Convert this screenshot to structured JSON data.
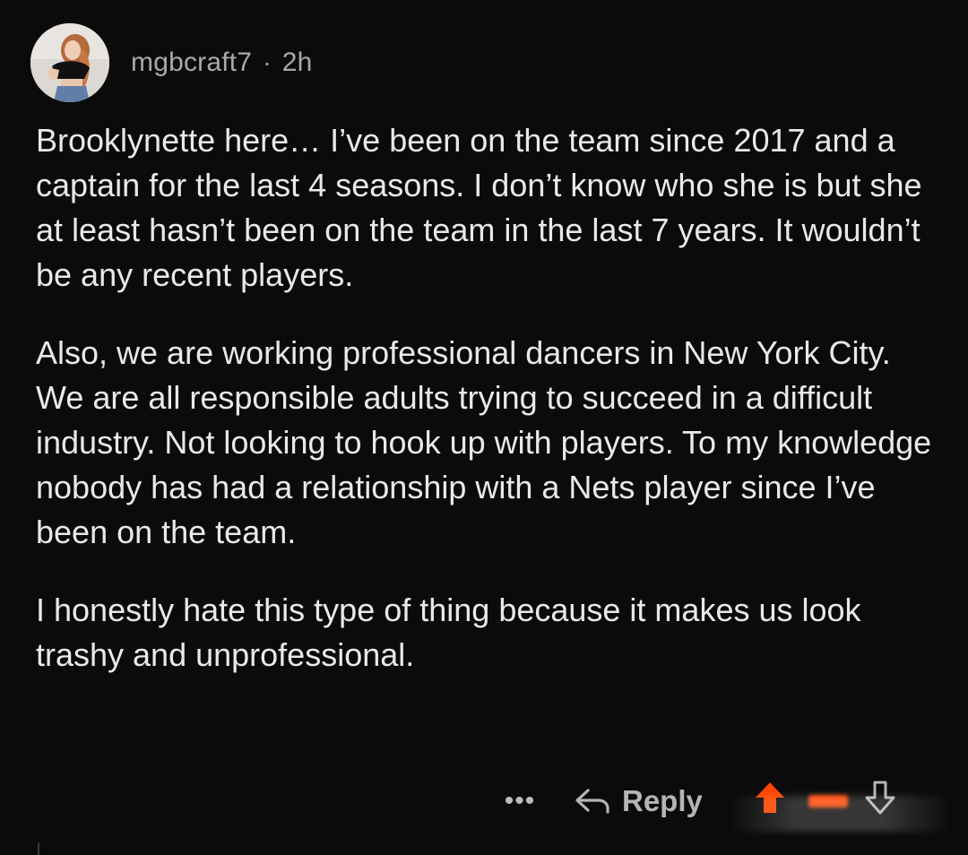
{
  "comment": {
    "author": "mgbcraft7",
    "separator": "·",
    "age": "2h",
    "paragraphs": [
      "Brooklynette here… I’ve been on the team since 2017 and a captain for the last 4 seasons. I don’t know who she is but she at least hasn’t been on the team in the last 7 years. It wouldn’t be any recent players.",
      "Also, we are working professional dancers in New York City. We are all responsible adults trying to succeed in a difficult industry. Not looking to hook up with players. To my knowledge nobody has had a relationship with a Nets player since I’ve been on the team.",
      "I honestly hate this type of thing because it makes us look trashy and unprofessional."
    ],
    "actions": {
      "more_label": "•••",
      "reply_label": "Reply",
      "score_text": "",
      "upvote_icon": "upvote-arrow-icon",
      "downvote_icon": "downvote-arrow-icon",
      "upvote_color": "#ff4500"
    }
  },
  "colors": {
    "background": "#0b0b0b",
    "text": "#e9e9e9",
    "meta": "#a9a9a9",
    "accent": "#ff4500"
  }
}
